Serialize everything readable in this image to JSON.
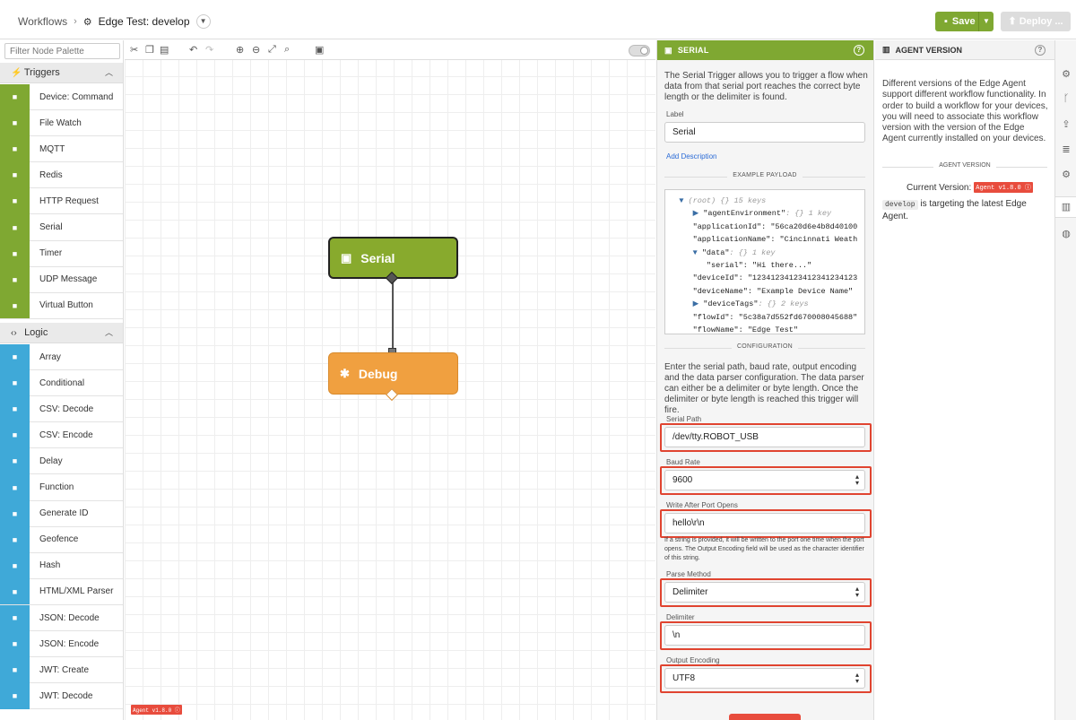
{
  "breadcrumb": {
    "root": "Workflows",
    "sep": "›",
    "current": "Edge Test: develop"
  },
  "header": {
    "save_label": "Save",
    "deploy_label": "Deploy ..."
  },
  "palette": {
    "filter_placeholder": "Filter Node Palette",
    "triggers_label": "Triggers",
    "triggers": [
      {
        "label": "Device: Command",
        "icon": "command-icon"
      },
      {
        "label": "File Watch",
        "icon": "folder-icon"
      },
      {
        "label": "MQTT",
        "icon": "mqtt-icon"
      },
      {
        "label": "Redis",
        "icon": "stack-icon"
      },
      {
        "label": "HTTP Request",
        "icon": "link-icon"
      },
      {
        "label": "Serial",
        "icon": "serial-icon"
      },
      {
        "label": "Timer",
        "icon": "timer-icon"
      },
      {
        "label": "UDP Message",
        "icon": "arrow-icon"
      },
      {
        "label": "Virtual Button",
        "icon": "button-icon"
      }
    ],
    "logic_label": "Logic",
    "logic": [
      {
        "label": "Array"
      },
      {
        "label": "Conditional"
      },
      {
        "label": "CSV: Decode"
      },
      {
        "label": "CSV: Encode"
      },
      {
        "label": "Delay"
      },
      {
        "label": "Function"
      },
      {
        "label": "Generate ID"
      },
      {
        "label": "Geofence"
      },
      {
        "label": "Hash"
      },
      {
        "label": "HTML/XML Parser"
      },
      {
        "label": "JSON: Decode"
      },
      {
        "label": "JSON: Encode"
      },
      {
        "label": "JWT: Create"
      },
      {
        "label": "JWT: Decode"
      }
    ]
  },
  "canvas": {
    "serial_node": "Serial",
    "debug_node": "Debug",
    "agent_badge": "Agent v1.8.0 ⓘ"
  },
  "serial_panel": {
    "title": "SERIAL",
    "description": "The Serial Trigger allows you to trigger a flow when data from that serial port reaches the correct byte length or the delimiter is found.",
    "label_label": "Label",
    "label_value": "Serial",
    "add_description": "Add Description",
    "example_payload_label": "EXAMPLE PAYLOAD",
    "payload_lines": [
      {
        "ind": "   ",
        "tri": "▼ ",
        "key": "(root)",
        "meta": " {} 15 keys",
        "val": ""
      },
      {
        "ind": "      ",
        "tri": "▶ ",
        "key": "\"agentEnvironment\"",
        "meta": ": {} 1 key",
        "val": ""
      },
      {
        "ind": "      ",
        "tri": "",
        "key": "\"applicationId\"",
        "meta": ": ",
        "val": "\"56ca20d6e4b8d40100"
      },
      {
        "ind": "      ",
        "tri": "",
        "key": "\"applicationName\"",
        "meta": ": ",
        "val": "\"Cincinnati Weath"
      },
      {
        "ind": "      ",
        "tri": "▼ ",
        "key": "\"data\"",
        "meta": ": {} 1 key",
        "val": ""
      },
      {
        "ind": "         ",
        "tri": "",
        "key": "\"serial\"",
        "meta": ": ",
        "val": "\"Hi there...\""
      },
      {
        "ind": "      ",
        "tri": "",
        "key": "\"deviceId\"",
        "meta": ": ",
        "val": "\"12341234123412341234123"
      },
      {
        "ind": "      ",
        "tri": "",
        "key": "\"deviceName\"",
        "meta": ": ",
        "val": "\"Example Device Name\""
      },
      {
        "ind": "      ",
        "tri": "▶ ",
        "key": "\"deviceTags\"",
        "meta": ": {} 2 keys",
        "val": ""
      },
      {
        "ind": "      ",
        "tri": "",
        "key": "\"flowId\"",
        "meta": ": ",
        "val": "\"5c38a7d552fd670008045688\""
      },
      {
        "ind": "      ",
        "tri": "",
        "key": "\"flowName\"",
        "meta": ": ",
        "val": "\"Edge Test\""
      }
    ],
    "configuration_label": "CONFIGURATION",
    "config_description": "Enter the serial path, baud rate, output encoding and the data parser configuration. The data parser can either be a delimiter or byte length. Once the delimiter or byte length is reached this trigger will fire.",
    "serial_path_label": "Serial Path",
    "serial_path_value": "/dev/tty.ROBOT_USB",
    "baud_rate_label": "Baud Rate",
    "baud_rate_value": "9600",
    "write_after_label": "Write After Port Opens",
    "write_after_value": "hello\\r\\n",
    "write_after_note": "If a string is provided, it will be written to the port one time when the port opens. The Output Encoding field will be used as the character identifier of this string.",
    "parse_method_label": "Parse Method",
    "parse_method_value": "Delimiter",
    "delimiter_label": "Delimiter",
    "delimiter_value": "\\n",
    "output_encoding_label": "Output Encoding",
    "output_encoding_value": "UTF8"
  },
  "agent_panel": {
    "title": "AGENT VERSION",
    "description": "Different versions of the Edge Agent support different workflow functionality. In order to build a workflow for your devices, you will need to associate this workflow version with the version of the Edge Agent currently installed on your devices.",
    "section_label": "AGENT VERSION",
    "current_label": "Current Version:",
    "current_badge": "Agent v1.8.0 ⓘ",
    "target_code": "develop",
    "target_text": "is targeting the latest Edge Agent."
  },
  "colors": {
    "accent_green": "#7fa832",
    "logic_blue": "#3fa9d8",
    "debug_orange": "#f0a040",
    "highlight_red": "#e04430"
  }
}
